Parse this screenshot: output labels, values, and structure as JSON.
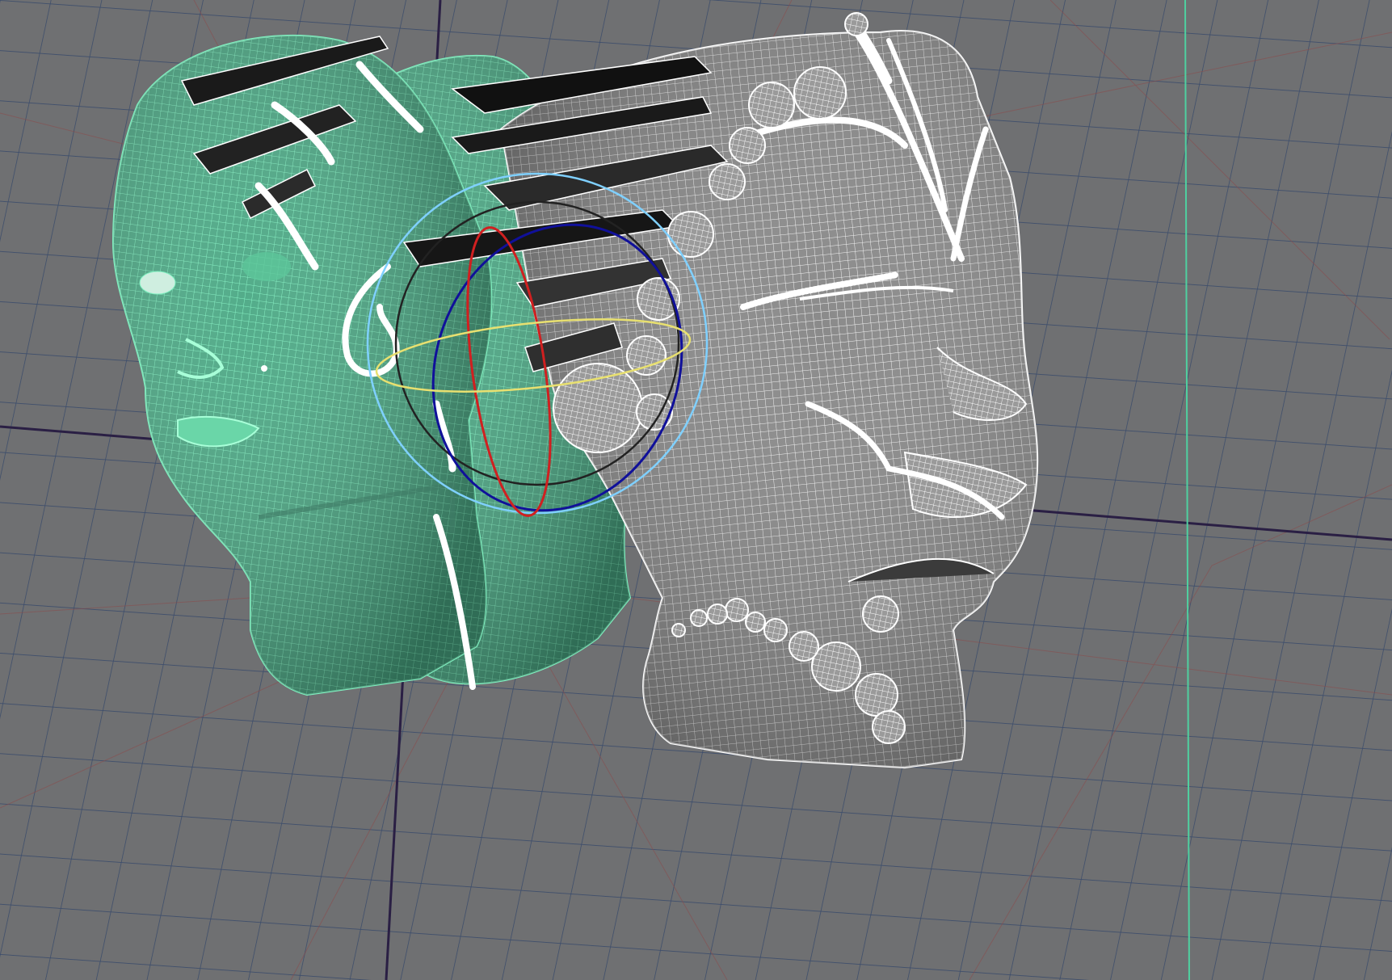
{
  "viewport": {
    "background": "#6f7072",
    "grid_line_color": "#3a4a66",
    "subgrid_line_color": "#8a4a4a",
    "axis_x_color": "#2a1f44",
    "axis_z_color": "#2a1f44",
    "view_divider_color": "#4fd0a0"
  },
  "scene": {
    "selected_mesh_color": "#5fe0a8",
    "unselected_mesh_color": "#ffffff",
    "mesh_fill_color": "#8c8c8c"
  },
  "rotate_manipulator": {
    "outer_ring_color": "#7fd0ff",
    "x_ring_color": "#d02020",
    "y_ring_color": "#e8e070",
    "z_ring_color": "#1010a0",
    "view_ring_color": "#222222"
  }
}
